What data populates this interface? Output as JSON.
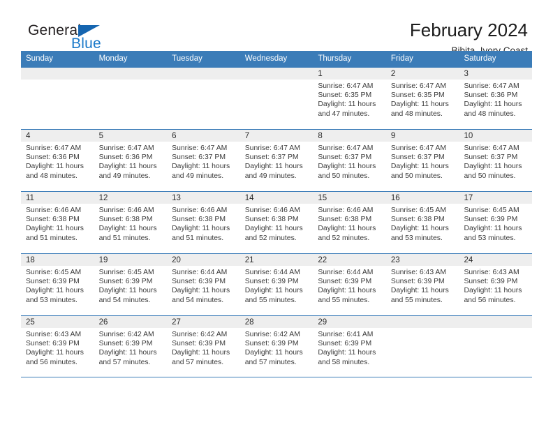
{
  "brand": {
    "word1": "General",
    "word2": "Blue",
    "triangle_color": "#1565b0",
    "word2_color": "#1a79c9"
  },
  "header": {
    "title": "February 2024",
    "location": "Bibita, Ivory Coast",
    "header_bg": "#3b7cb8",
    "daynum_bg": "#eeeeee"
  },
  "calendar": {
    "weekday_headers": [
      "Sunday",
      "Monday",
      "Tuesday",
      "Wednesday",
      "Thursday",
      "Friday",
      "Saturday"
    ],
    "weeks": [
      [
        {
          "day": "",
          "sunrise": "",
          "sunset": "",
          "daylight_line1": "",
          "daylight_line2": ""
        },
        {
          "day": "",
          "sunrise": "",
          "sunset": "",
          "daylight_line1": "",
          "daylight_line2": ""
        },
        {
          "day": "",
          "sunrise": "",
          "sunset": "",
          "daylight_line1": "",
          "daylight_line2": ""
        },
        {
          "day": "",
          "sunrise": "",
          "sunset": "",
          "daylight_line1": "",
          "daylight_line2": ""
        },
        {
          "day": "1",
          "sunrise": "Sunrise: 6:47 AM",
          "sunset": "Sunset: 6:35 PM",
          "daylight_line1": "Daylight: 11 hours",
          "daylight_line2": "and 47 minutes."
        },
        {
          "day": "2",
          "sunrise": "Sunrise: 6:47 AM",
          "sunset": "Sunset: 6:35 PM",
          "daylight_line1": "Daylight: 11 hours",
          "daylight_line2": "and 48 minutes."
        },
        {
          "day": "3",
          "sunrise": "Sunrise: 6:47 AM",
          "sunset": "Sunset: 6:36 PM",
          "daylight_line1": "Daylight: 11 hours",
          "daylight_line2": "and 48 minutes."
        }
      ],
      [
        {
          "day": "4",
          "sunrise": "Sunrise: 6:47 AM",
          "sunset": "Sunset: 6:36 PM",
          "daylight_line1": "Daylight: 11 hours",
          "daylight_line2": "and 48 minutes."
        },
        {
          "day": "5",
          "sunrise": "Sunrise: 6:47 AM",
          "sunset": "Sunset: 6:36 PM",
          "daylight_line1": "Daylight: 11 hours",
          "daylight_line2": "and 49 minutes."
        },
        {
          "day": "6",
          "sunrise": "Sunrise: 6:47 AM",
          "sunset": "Sunset: 6:37 PM",
          "daylight_line1": "Daylight: 11 hours",
          "daylight_line2": "and 49 minutes."
        },
        {
          "day": "7",
          "sunrise": "Sunrise: 6:47 AM",
          "sunset": "Sunset: 6:37 PM",
          "daylight_line1": "Daylight: 11 hours",
          "daylight_line2": "and 49 minutes."
        },
        {
          "day": "8",
          "sunrise": "Sunrise: 6:47 AM",
          "sunset": "Sunset: 6:37 PM",
          "daylight_line1": "Daylight: 11 hours",
          "daylight_line2": "and 50 minutes."
        },
        {
          "day": "9",
          "sunrise": "Sunrise: 6:47 AM",
          "sunset": "Sunset: 6:37 PM",
          "daylight_line1": "Daylight: 11 hours",
          "daylight_line2": "and 50 minutes."
        },
        {
          "day": "10",
          "sunrise": "Sunrise: 6:47 AM",
          "sunset": "Sunset: 6:37 PM",
          "daylight_line1": "Daylight: 11 hours",
          "daylight_line2": "and 50 minutes."
        }
      ],
      [
        {
          "day": "11",
          "sunrise": "Sunrise: 6:46 AM",
          "sunset": "Sunset: 6:38 PM",
          "daylight_line1": "Daylight: 11 hours",
          "daylight_line2": "and 51 minutes."
        },
        {
          "day": "12",
          "sunrise": "Sunrise: 6:46 AM",
          "sunset": "Sunset: 6:38 PM",
          "daylight_line1": "Daylight: 11 hours",
          "daylight_line2": "and 51 minutes."
        },
        {
          "day": "13",
          "sunrise": "Sunrise: 6:46 AM",
          "sunset": "Sunset: 6:38 PM",
          "daylight_line1": "Daylight: 11 hours",
          "daylight_line2": "and 51 minutes."
        },
        {
          "day": "14",
          "sunrise": "Sunrise: 6:46 AM",
          "sunset": "Sunset: 6:38 PM",
          "daylight_line1": "Daylight: 11 hours",
          "daylight_line2": "and 52 minutes."
        },
        {
          "day": "15",
          "sunrise": "Sunrise: 6:46 AM",
          "sunset": "Sunset: 6:38 PM",
          "daylight_line1": "Daylight: 11 hours",
          "daylight_line2": "and 52 minutes."
        },
        {
          "day": "16",
          "sunrise": "Sunrise: 6:45 AM",
          "sunset": "Sunset: 6:38 PM",
          "daylight_line1": "Daylight: 11 hours",
          "daylight_line2": "and 53 minutes."
        },
        {
          "day": "17",
          "sunrise": "Sunrise: 6:45 AM",
          "sunset": "Sunset: 6:39 PM",
          "daylight_line1": "Daylight: 11 hours",
          "daylight_line2": "and 53 minutes."
        }
      ],
      [
        {
          "day": "18",
          "sunrise": "Sunrise: 6:45 AM",
          "sunset": "Sunset: 6:39 PM",
          "daylight_line1": "Daylight: 11 hours",
          "daylight_line2": "and 53 minutes."
        },
        {
          "day": "19",
          "sunrise": "Sunrise: 6:45 AM",
          "sunset": "Sunset: 6:39 PM",
          "daylight_line1": "Daylight: 11 hours",
          "daylight_line2": "and 54 minutes."
        },
        {
          "day": "20",
          "sunrise": "Sunrise: 6:44 AM",
          "sunset": "Sunset: 6:39 PM",
          "daylight_line1": "Daylight: 11 hours",
          "daylight_line2": "and 54 minutes."
        },
        {
          "day": "21",
          "sunrise": "Sunrise: 6:44 AM",
          "sunset": "Sunset: 6:39 PM",
          "daylight_line1": "Daylight: 11 hours",
          "daylight_line2": "and 55 minutes."
        },
        {
          "day": "22",
          "sunrise": "Sunrise: 6:44 AM",
          "sunset": "Sunset: 6:39 PM",
          "daylight_line1": "Daylight: 11 hours",
          "daylight_line2": "and 55 minutes."
        },
        {
          "day": "23",
          "sunrise": "Sunrise: 6:43 AM",
          "sunset": "Sunset: 6:39 PM",
          "daylight_line1": "Daylight: 11 hours",
          "daylight_line2": "and 55 minutes."
        },
        {
          "day": "24",
          "sunrise": "Sunrise: 6:43 AM",
          "sunset": "Sunset: 6:39 PM",
          "daylight_line1": "Daylight: 11 hours",
          "daylight_line2": "and 56 minutes."
        }
      ],
      [
        {
          "day": "25",
          "sunrise": "Sunrise: 6:43 AM",
          "sunset": "Sunset: 6:39 PM",
          "daylight_line1": "Daylight: 11 hours",
          "daylight_line2": "and 56 minutes."
        },
        {
          "day": "26",
          "sunrise": "Sunrise: 6:42 AM",
          "sunset": "Sunset: 6:39 PM",
          "daylight_line1": "Daylight: 11 hours",
          "daylight_line2": "and 57 minutes."
        },
        {
          "day": "27",
          "sunrise": "Sunrise: 6:42 AM",
          "sunset": "Sunset: 6:39 PM",
          "daylight_line1": "Daylight: 11 hours",
          "daylight_line2": "and 57 minutes."
        },
        {
          "day": "28",
          "sunrise": "Sunrise: 6:42 AM",
          "sunset": "Sunset: 6:39 PM",
          "daylight_line1": "Daylight: 11 hours",
          "daylight_line2": "and 57 minutes."
        },
        {
          "day": "29",
          "sunrise": "Sunrise: 6:41 AM",
          "sunset": "Sunset: 6:39 PM",
          "daylight_line1": "Daylight: 11 hours",
          "daylight_line2": "and 58 minutes."
        },
        {
          "day": "",
          "sunrise": "",
          "sunset": "",
          "daylight_line1": "",
          "daylight_line2": ""
        },
        {
          "day": "",
          "sunrise": "",
          "sunset": "",
          "daylight_line1": "",
          "daylight_line2": ""
        }
      ]
    ]
  }
}
